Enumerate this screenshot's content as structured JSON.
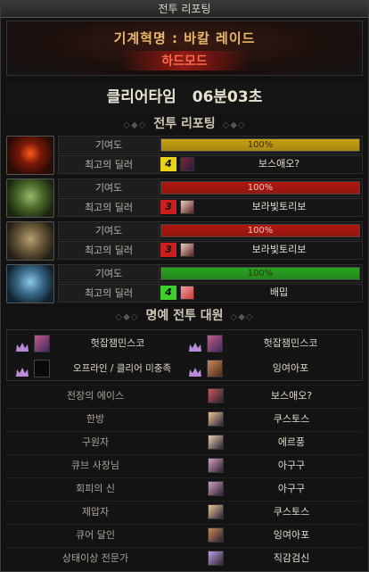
{
  "window": {
    "title": "전투 리포팅"
  },
  "header": {
    "raid_title": "기계혁명 : 바칼 레이드",
    "mode": "하드모드"
  },
  "clear_time": {
    "label": "클리어타임",
    "value": "06분03초"
  },
  "sections": {
    "report": "전투 리포팅",
    "honor": "명예 전투 대원"
  },
  "row_labels": {
    "contribution": "기여도",
    "top_dealer": "최고의 딜러"
  },
  "parties": [
    {
      "contribution_text": "100%",
      "contribution": 1.0,
      "bar_color": "#c9a211",
      "rank": "4",
      "badge_color": "#e8d21a",
      "dealer": "보스애오?"
    },
    {
      "contribution_text": "100%",
      "contribution": 1.0,
      "bar_color": "#b0170f",
      "rank": "3",
      "badge_color": "#cc1f1f",
      "dealer": "보라빛토리보"
    },
    {
      "contribution_text": "100%",
      "contribution": 1.0,
      "bar_color": "#b0170f",
      "rank": "3",
      "badge_color": "#cc1f1f",
      "dealer": "보라빛토리보"
    },
    {
      "contribution_text": "100%",
      "contribution": 1.0,
      "bar_color": "#27a31f",
      "rank": "4",
      "badge_color": "#3fcf2a",
      "dealer": "배밉"
    }
  ],
  "honor": {
    "row1": {
      "left": "헛잡잼민스코",
      "right": "헛잡잼민스코"
    },
    "row2": {
      "left_status": "오프라인 / 클리어 미충족",
      "right": "잉여아포"
    }
  },
  "awards": [
    {
      "label": "전장의 에이스",
      "name": "보스애오?"
    },
    {
      "label": "한방",
      "name": "쿠스토스"
    },
    {
      "label": "구원자",
      "name": "에르풍"
    },
    {
      "label": "큐브 사장님",
      "name": "아구구"
    },
    {
      "label": "회피의 신",
      "name": "아구구"
    },
    {
      "label": "제압자",
      "name": "쿠스토스"
    },
    {
      "label": "큐어 달인",
      "name": "잉여아포"
    },
    {
      "label": "상태이상 전문가",
      "name": "직감검신"
    }
  ]
}
